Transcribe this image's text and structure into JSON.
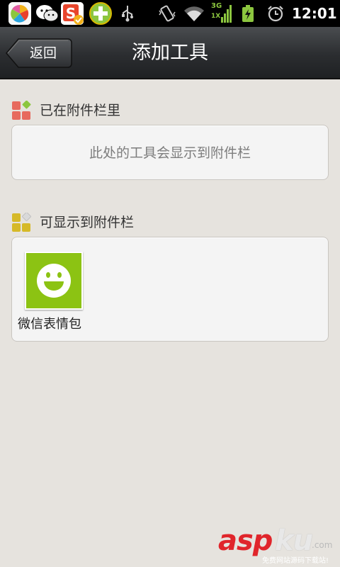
{
  "status_bar": {
    "time": "12:01",
    "network_label": "3G",
    "network_sub": "1X",
    "notification_icons": [
      "app-store-icon",
      "wechat-icon",
      "sogou-input-icon",
      "360-security-icon",
      "usb-icon"
    ],
    "system_icons": [
      "vibrate-icon",
      "wifi-icon",
      "signal-3g-icon",
      "battery-charging-icon",
      "alarm-icon"
    ]
  },
  "header": {
    "back_label": "返回",
    "title": "添加工具"
  },
  "sections": {
    "in_bar": {
      "heading": "已在附件栏里",
      "empty_hint": "此处的工具会显示到附件栏"
    },
    "available": {
      "heading": "可显示到附件栏",
      "tools": [
        {
          "label": "微信表情包",
          "icon": "smiley-face-icon"
        }
      ]
    }
  },
  "watermark": {
    "brand_a": "asp",
    "brand_b": "ku",
    "suffix": ".com",
    "tagline": "免费网站源码下载站!"
  },
  "colors": {
    "background": "#e6e3de",
    "title_bar": "#2b2d30",
    "tool_icon_green": "#8cc313",
    "section1_icon": "#e76a5e",
    "section2_icon": "#d6b928",
    "watermark_red": "#e0252b"
  }
}
